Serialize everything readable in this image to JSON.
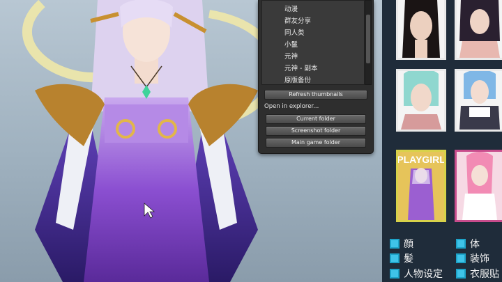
{
  "folder_list": {
    "items": [
      "动漫",
      "群友分享",
      "同人类",
      "小鬣",
      "元神",
      "元神 - 副本",
      "原版备份"
    ]
  },
  "actions": {
    "refresh_thumbnails": "Refresh thumbnails",
    "open_in_explorer": "Open in explorer...",
    "current_folder": "Current folder",
    "screenshot_folder": "Screenshot folder",
    "main_game_folder": "Main game folder"
  },
  "thumbnails": {
    "magazine_title": "PLAYGIRL"
  },
  "load_options": {
    "face": "顔",
    "body": "体",
    "hair": "髪",
    "accessories": "装饰",
    "character_settings": "人物设定",
    "clothing": "衣服贴"
  },
  "colors": {
    "panel_bg": "#2e2e2e",
    "checkbox": "#3fc3e8",
    "selected_border": "#d8d24a"
  }
}
